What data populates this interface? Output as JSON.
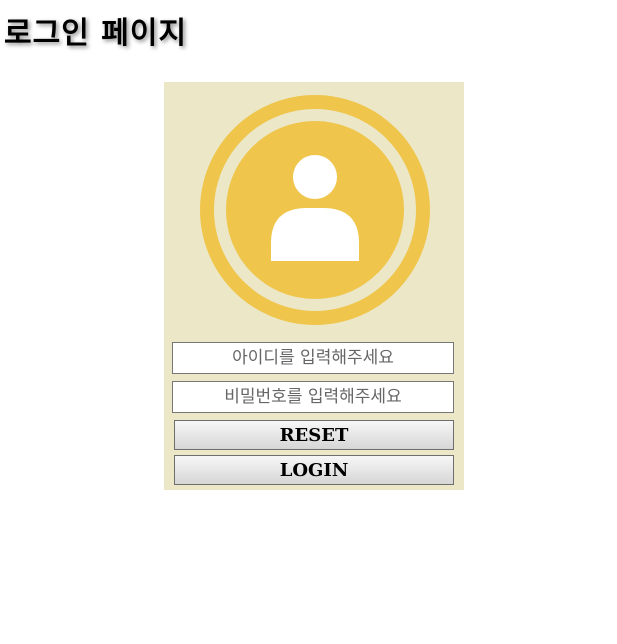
{
  "page": {
    "title": "로그인 페이지"
  },
  "login": {
    "avatar_icon": "user-icon",
    "id_placeholder": "아이디를 입력해주세요",
    "id_value": "",
    "password_placeholder": "비밀번호를 입력해주세요",
    "password_value": "",
    "reset_label": "RESET",
    "login_label": "LOGIN"
  },
  "colors": {
    "box_background": "#ece7c6",
    "avatar_yellow": "#efc54b",
    "avatar_inner_ring": "#ece7c6",
    "avatar_figure": "#ffffff"
  }
}
